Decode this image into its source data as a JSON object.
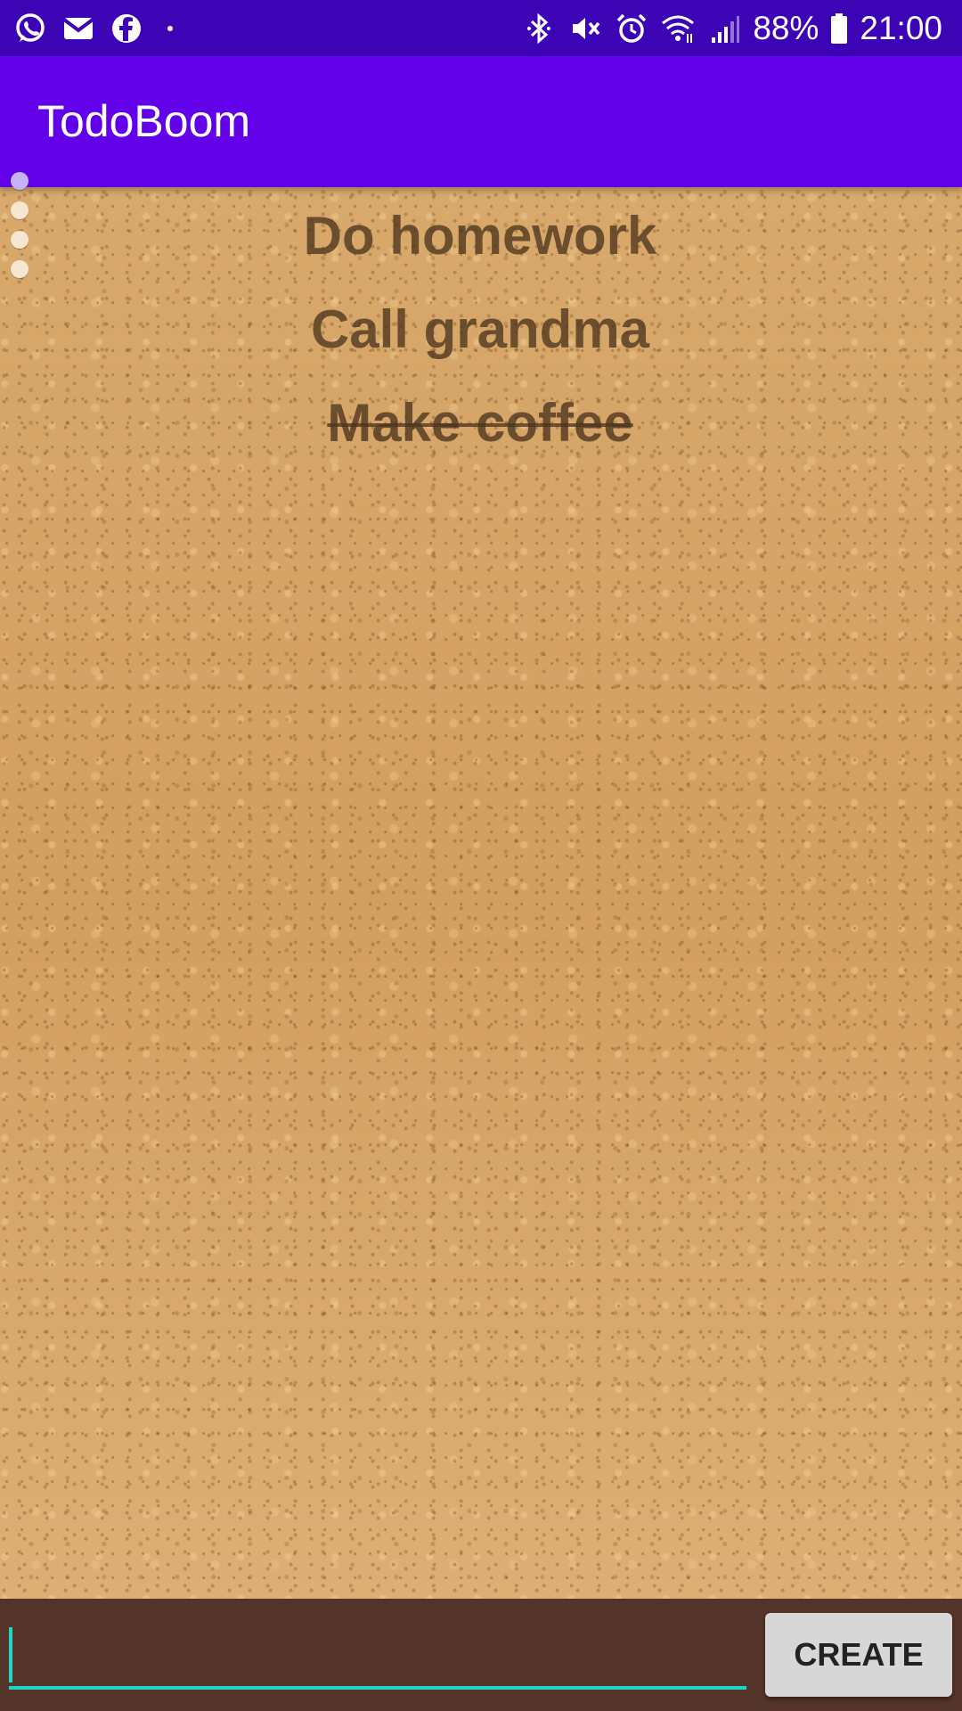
{
  "status_bar": {
    "left_icons": [
      "whatsapp-icon",
      "gmail-icon",
      "facebook-icon",
      "notification-dot-icon"
    ],
    "right_icons": [
      "bluetooth-icon",
      "vibrate-mute-icon",
      "alarm-icon",
      "wifi-icon",
      "signal-icon"
    ],
    "battery_percent": "88%",
    "time": "21:00"
  },
  "app_bar": {
    "title": "TodoBoom",
    "color": "#6200ea"
  },
  "page_indicator": {
    "count": 4,
    "active_index": 0
  },
  "todos": [
    {
      "text": "Do homework",
      "done": false
    },
    {
      "text": "Call grandma",
      "done": false
    },
    {
      "text": "Make coffee",
      "done": true
    }
  ],
  "input": {
    "value": "",
    "placeholder": "",
    "accent_color": "#1fd6c2"
  },
  "create_button": {
    "label": "CREATE"
  }
}
